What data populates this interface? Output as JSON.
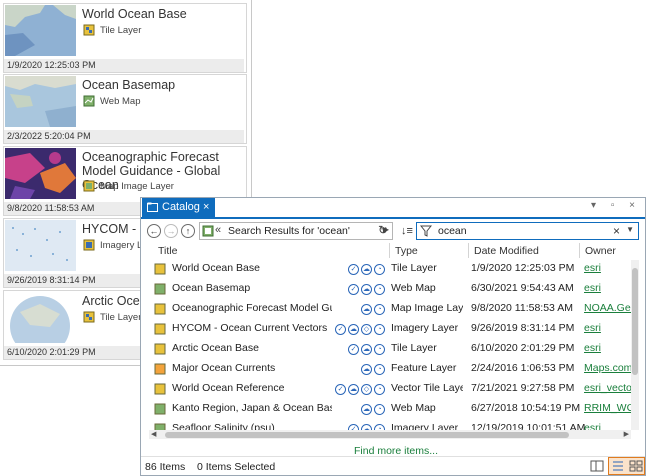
{
  "gallery": {
    "cards": [
      {
        "title": "World Ocean Base",
        "type": "Tile Layer",
        "date": "1/9/2020 12:25:03 PM"
      },
      {
        "title": "Ocean Basemap",
        "type": "Web Map",
        "date": "2/3/2022 5:20:04 PM"
      },
      {
        "title": "Oceanographic Forecast Model Guidance - Global Ocean",
        "type": "Map Image Layer",
        "date": "9/8/2020 11:58:53 AM"
      },
      {
        "title": "HYCOM - Oc",
        "type": "Imagery La",
        "date": "9/26/2019 8:31:14 PM"
      },
      {
        "title": "Arctic Ocean",
        "type": "Tile Layer",
        "date": "6/10/2020 2:01:29 PM"
      }
    ]
  },
  "catalog": {
    "tab_label": "Catalog",
    "close_glyph": "×",
    "window_controls": "▾ ▫ ×",
    "breadcrumb": "Search Results for 'ocean'",
    "breadcrumb_prefix": "«",
    "search_value": "ocean",
    "columns": [
      "Title",
      "Type",
      "Date Modified",
      "Owner"
    ],
    "rows": [
      {
        "title": "World Ocean Base",
        "badges": [
          "✓",
          "☁",
          "◔"
        ],
        "type": "Tile Layer",
        "date": "1/9/2020 12:25:03 PM",
        "owner": "esri"
      },
      {
        "title": "Ocean Basemap",
        "badges": [
          "✓",
          "☁",
          "◔"
        ],
        "type": "Web Map",
        "date": "6/30/2021 9:54:43 AM",
        "owner": "esri"
      },
      {
        "title": "Oceanographic Forecast Model Guidance",
        "badges": [
          "☁",
          "◔"
        ],
        "type": "Map Image Layer",
        "date": "9/8/2020 11:58:53 AM",
        "owner": "NOAA.Geo"
      },
      {
        "title": "HYCOM - Ocean Current Vectors",
        "badges": [
          "✓",
          "☁",
          "◇",
          "◔"
        ],
        "type": "Imagery Layer",
        "date": "9/26/2019 8:31:14 PM",
        "owner": "esri"
      },
      {
        "title": "Arctic Ocean Base",
        "badges": [
          "✓",
          "☁",
          "◔"
        ],
        "type": "Tile Layer",
        "date": "6/10/2020 2:01:29 PM",
        "owner": "esri"
      },
      {
        "title": "Major Ocean Currents",
        "badges": [
          "☁",
          "◔"
        ],
        "type": "Feature Layer",
        "date": "2/24/2016 1:06:53 PM",
        "owner": "Maps.com"
      },
      {
        "title": "World Ocean Reference",
        "badges": [
          "✓",
          "☁",
          "◇",
          "◔"
        ],
        "type": "Vector Tile Layer",
        "date": "7/21/2021 9:27:58 PM",
        "owner": "esri_vector"
      },
      {
        "title": "Kanto Region, Japan & Ocean Base Topogr",
        "badges": [
          "☁",
          "◔"
        ],
        "type": "Web Map",
        "date": "6/27/2018 10:54:19 PM",
        "owner": "RRIM_WG"
      },
      {
        "title": "Seafloor Salinity (psu)",
        "badges": [
          "✓",
          "☁",
          "◔"
        ],
        "type": "Imagery Layer",
        "date": "12/19/2019 10:01:51 AM",
        "owner": "esri"
      }
    ],
    "find_more": "Find more items...",
    "item_count": "86 Items",
    "items_selected": "0 Items Selected"
  }
}
